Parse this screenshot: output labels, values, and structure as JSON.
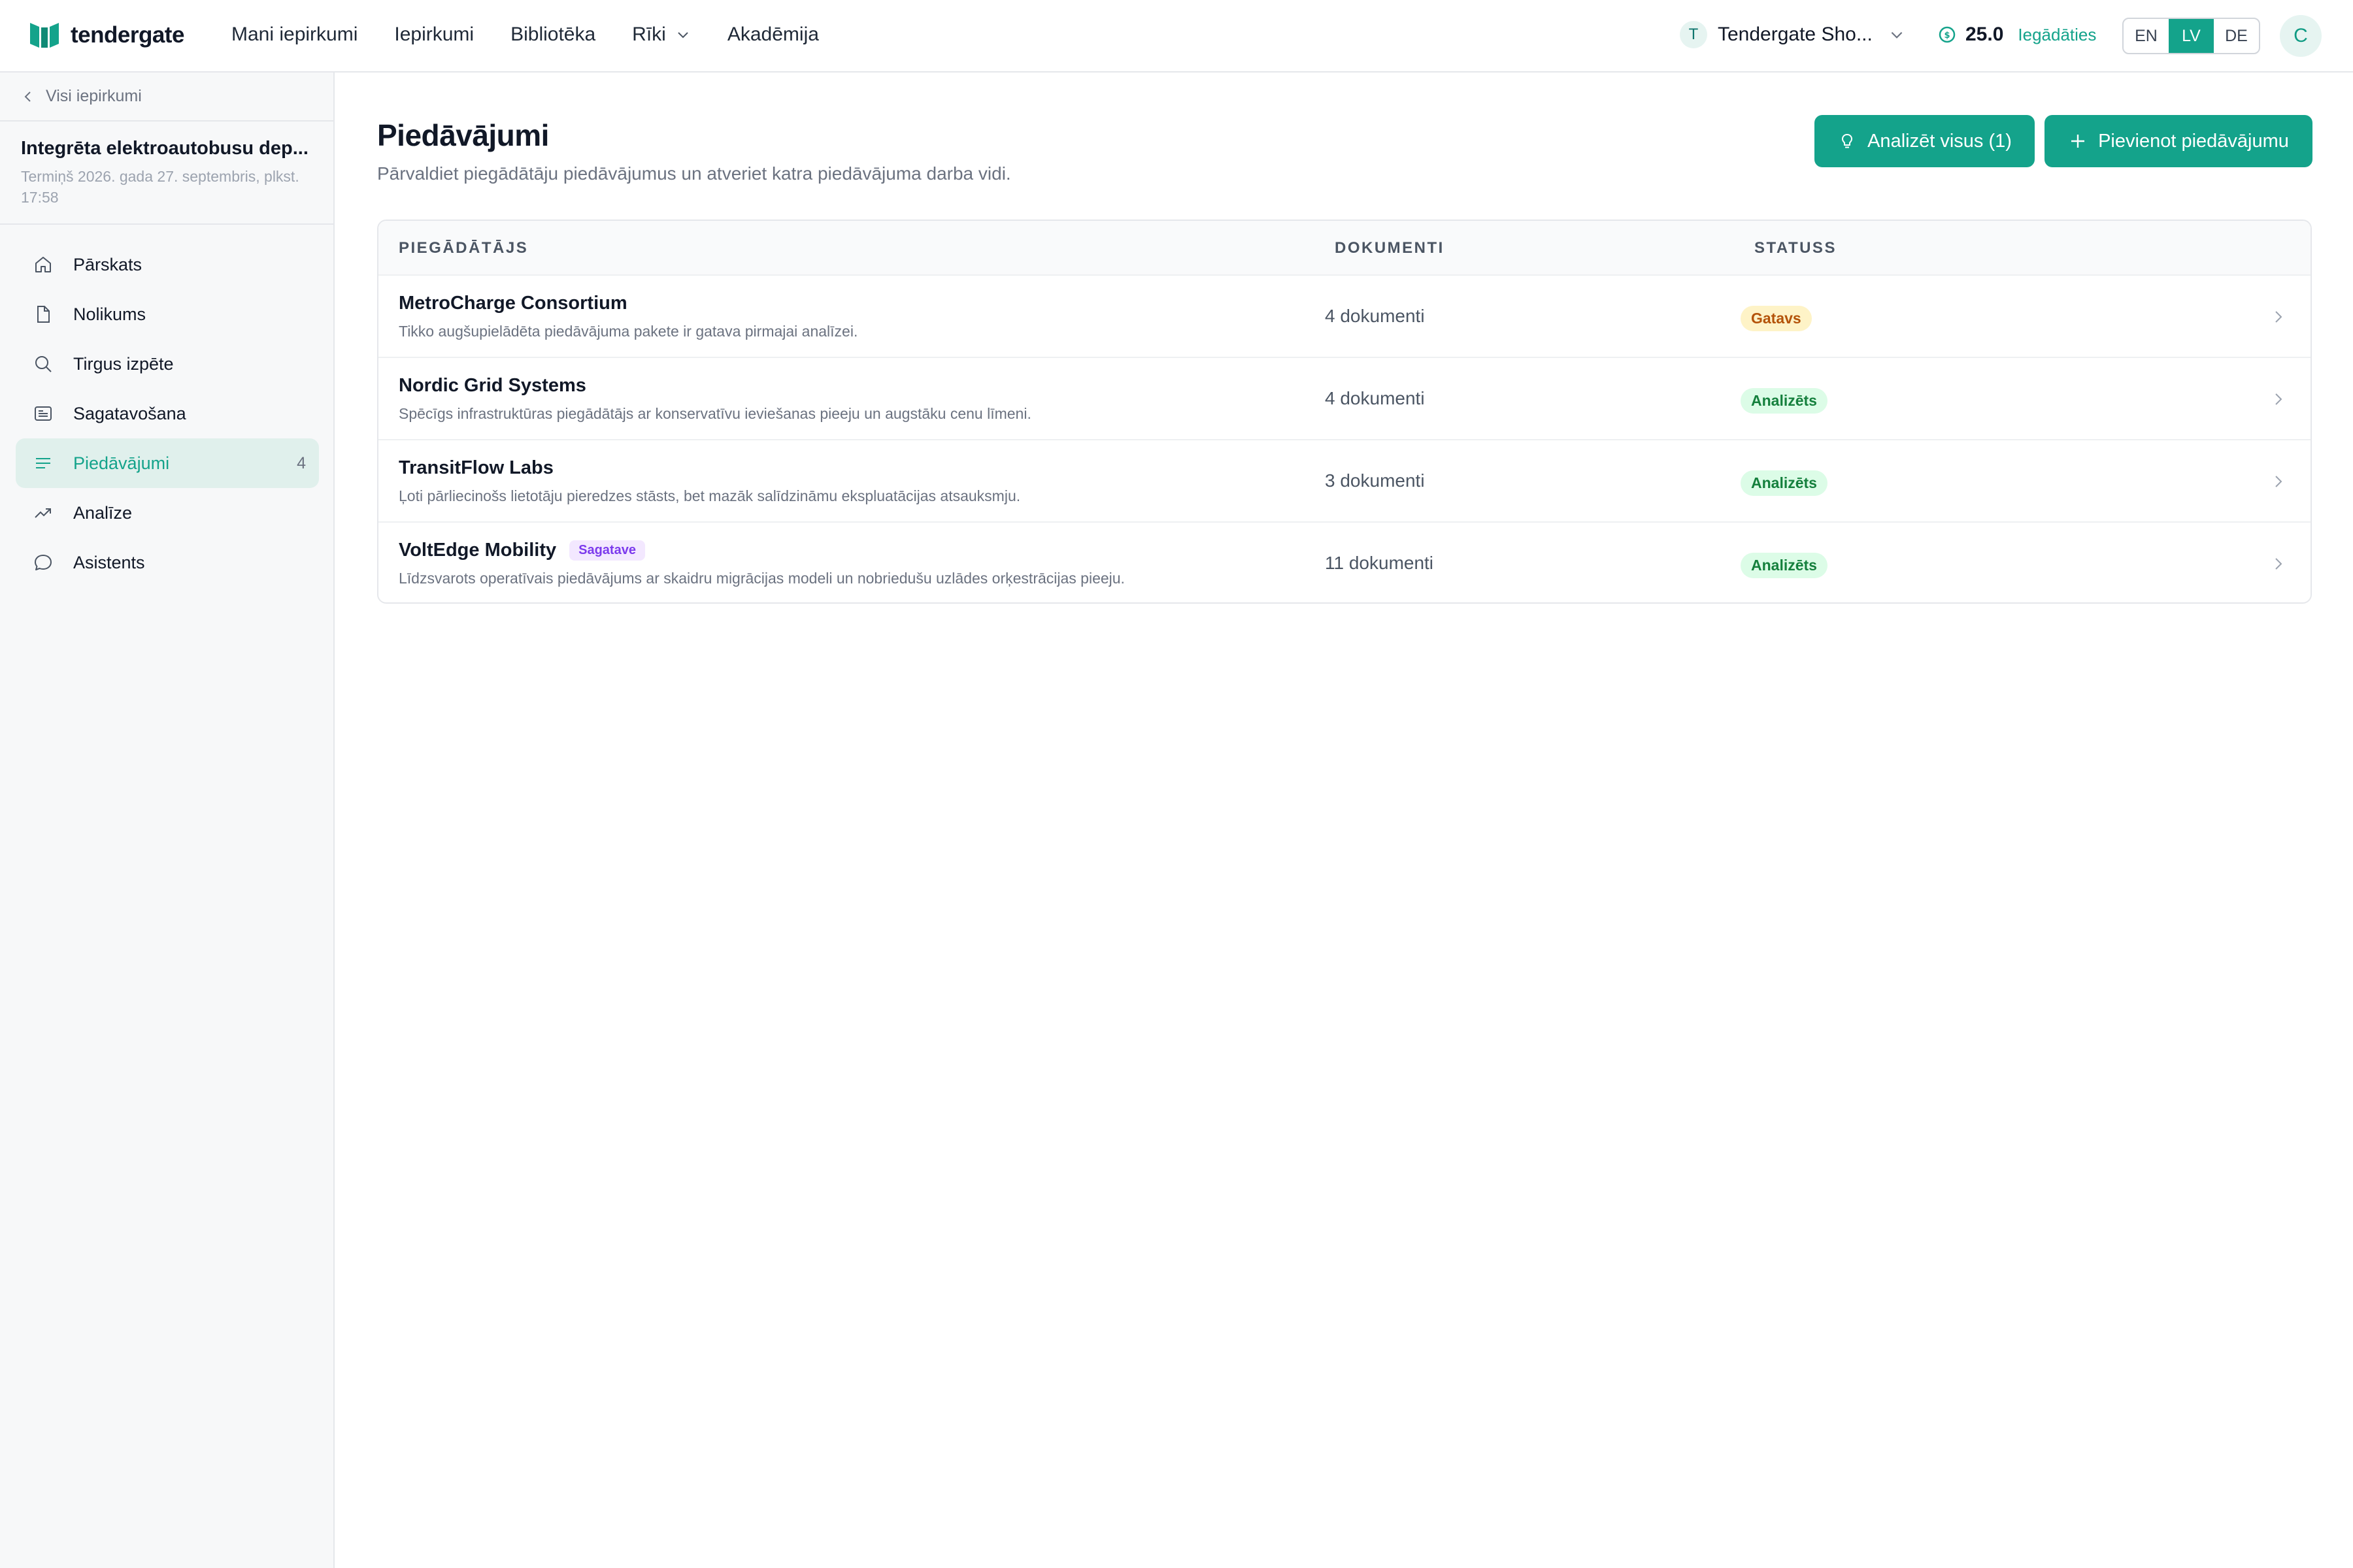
{
  "brand": {
    "name": "tendergate",
    "color": "#14a38b"
  },
  "nav": [
    {
      "label": "Mani iepirkumi"
    },
    {
      "label": "Iepirkumi"
    },
    {
      "label": "Bibliotēka"
    },
    {
      "label": "Rīki",
      "dropdown": true
    },
    {
      "label": "Akadēmija"
    }
  ],
  "org": {
    "initial": "T",
    "name": "Tendergate Sho..."
  },
  "credits": {
    "value": "25.0",
    "link": "Iegādāties"
  },
  "languages": [
    {
      "code": "EN",
      "active": false
    },
    {
      "code": "LV",
      "active": true
    },
    {
      "code": "DE",
      "active": false
    }
  ],
  "user": {
    "initial": "C"
  },
  "sidebar": {
    "back_label": "Visi iepirkumi",
    "project_title": "Integrēta elektroautobusu dep...",
    "project_deadline": "Termiņš 2026. gada 27. septembris, plkst. 17:58",
    "items": [
      {
        "label": "Pārskats",
        "icon": "home-icon",
        "count": ""
      },
      {
        "label": "Nolikums",
        "icon": "document-icon",
        "count": ""
      },
      {
        "label": "Tirgus izpēte",
        "icon": "search-icon",
        "count": ""
      },
      {
        "label": "Sagatavošana",
        "icon": "newspaper-icon",
        "count": ""
      },
      {
        "label": "Piedāvājumi",
        "icon": "list-icon",
        "count": "4",
        "active": true
      },
      {
        "label": "Analīze",
        "icon": "trending-icon",
        "count": ""
      },
      {
        "label": "Asistents",
        "icon": "chat-icon",
        "count": ""
      }
    ]
  },
  "main": {
    "title": "Piedāvājumi",
    "subtitle": "Pārvaldiet piegādātāju piedāvājumus un atveriet katra piedāvājuma darba vidi.",
    "analyze_button": "Analizēt visus (1)",
    "add_button": "Pievienot piedāvājumu",
    "table": {
      "headers": {
        "supplier": "PIEGĀDĀTĀJS",
        "documents": "DOKUMENTI",
        "status": "STATUSS"
      },
      "rows": [
        {
          "name": "MetroCharge Consortium",
          "badge": "",
          "desc": "Tikko augšupielādēta piedāvājuma pakete ir gatava pirmajai analīzei.",
          "docs": "4 dokumenti",
          "status": "Gatavs",
          "status_type": "ready"
        },
        {
          "name": "Nordic Grid Systems",
          "badge": "",
          "desc": "Spēcīgs infrastruktūras piegādātājs ar konservatīvu ieviešanas pieeju un augstāku cenu līmeni.",
          "docs": "4 dokumenti",
          "status": "Analizēts",
          "status_type": "analyzed"
        },
        {
          "name": "TransitFlow Labs",
          "badge": "",
          "desc": "Ļoti pārliecinošs lietotāju pieredzes stāsts, bet mazāk salīdzināmu ekspluatācijas atsauksmju.",
          "docs": "3 dokumenti",
          "status": "Analizēts",
          "status_type": "analyzed"
        },
        {
          "name": "VoltEdge Mobility",
          "badge": "Sagatave",
          "desc": "Līdzsvarots operatīvais piedāvājums ar skaidru migrācijas modeli un nobriedušu uzlādes orķestrācijas pieeju.",
          "docs": "11 dokumenti",
          "status": "Analizēts",
          "status_type": "analyzed"
        }
      ]
    }
  }
}
